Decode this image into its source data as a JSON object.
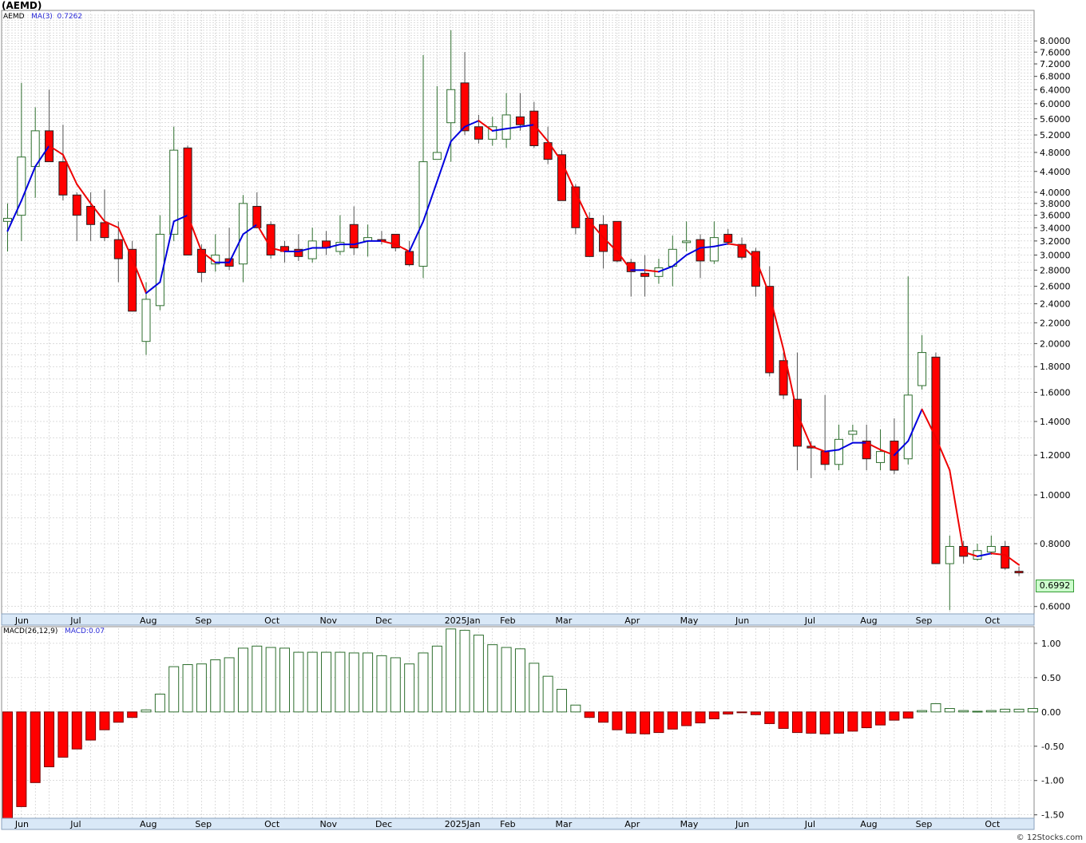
{
  "ticker": "(AEMD)",
  "legend_price": {
    "symbol": "AEMD",
    "ma_label": "MA(3)",
    "ma_value": "0.7262"
  },
  "legend_macd": {
    "label": "MACD(26,12,9)",
    "value_label": "MACD:0.07"
  },
  "last_price": "0.6992",
  "credit": "© 12Stocks.com",
  "colors": {
    "up_stroke": "#2e6e2e",
    "down_fill": "#ff0000",
    "ma_up": "#0000dd",
    "ma_down": "#ee0000",
    "grid": "#bbbbbb",
    "badge_bg": "#ccffcc"
  },
  "chart_data": [
    {
      "type": "candlestick",
      "title": "(AEMD)",
      "scale": "log",
      "ylim": [
        0.58,
        9.2
      ],
      "y_tick_labels": [
        "8.0000",
        "7.6000",
        "7.2000",
        "6.8000",
        "6.4000",
        "6.0000",
        "5.6000",
        "5.2000",
        "4.8000",
        "4.4000",
        "4.0000",
        "3.8000",
        "3.6000",
        "3.4000",
        "3.2000",
        "3.0000",
        "2.8000",
        "2.6000",
        "2.4000",
        "2.2000",
        "2.0000",
        "1.8000",
        "1.6000",
        "1.4000",
        "1.2000",
        "1.0000",
        "0.8000",
        "0.6000"
      ],
      "x_month_labels": [
        {
          "label": "Jun",
          "week": 1
        },
        {
          "label": "Jul",
          "week": 5
        },
        {
          "label": "Aug",
          "week": 10
        },
        {
          "label": "Sep",
          "week": 14
        },
        {
          "label": "Oct",
          "week": 19
        },
        {
          "label": "Nov",
          "week": 23
        },
        {
          "label": "Dec",
          "week": 27
        },
        {
          "label": "2025Jan",
          "week": 32
        },
        {
          "label": "Feb",
          "week": 36
        },
        {
          "label": "Mar",
          "week": 40
        },
        {
          "label": "Apr",
          "week": 45
        },
        {
          "label": "May",
          "week": 49
        },
        {
          "label": "Jun",
          "week": 53
        },
        {
          "label": "Jul",
          "week": 58
        },
        {
          "label": "Aug",
          "week": 62
        },
        {
          "label": "Sep",
          "week": 66
        },
        {
          "label": "Oct",
          "week": 71
        }
      ],
      "ohlc": [
        [
          3.5,
          3.8,
          3.05,
          3.55
        ],
        [
          3.6,
          6.6,
          3.2,
          4.7
        ],
        [
          4.5,
          5.9,
          3.9,
          5.3
        ],
        [
          5.3,
          6.4,
          4.6,
          4.6
        ],
        [
          4.6,
          5.45,
          3.85,
          3.95
        ],
        [
          3.95,
          4.0,
          3.2,
          3.6
        ],
        [
          3.75,
          4.0,
          3.2,
          3.45
        ],
        [
          3.48,
          4.05,
          3.2,
          3.25
        ],
        [
          3.22,
          3.5,
          2.65,
          2.95
        ],
        [
          3.08,
          3.2,
          2.45,
          2.32
        ],
        [
          2.02,
          2.65,
          1.9,
          2.45
        ],
        [
          2.38,
          3.6,
          2.33,
          3.3
        ],
        [
          3.3,
          5.4,
          3.2,
          4.85
        ],
        [
          4.9,
          4.95,
          3.0,
          3.0
        ],
        [
          3.08,
          3.15,
          2.65,
          2.77
        ],
        [
          2.88,
          3.3,
          2.78,
          3.0
        ],
        [
          2.95,
          3.4,
          2.8,
          2.85
        ],
        [
          2.88,
          3.95,
          2.65,
          3.8
        ],
        [
          3.75,
          4.0,
          3.4,
          3.4
        ],
        [
          3.45,
          3.5,
          2.95,
          3.0
        ],
        [
          3.12,
          3.2,
          2.9,
          3.05
        ],
        [
          3.08,
          3.3,
          2.92,
          2.98
        ],
        [
          2.95,
          3.4,
          2.9,
          3.2
        ],
        [
          3.2,
          3.35,
          3.0,
          3.1
        ],
        [
          3.05,
          3.6,
          3.0,
          3.18
        ],
        [
          3.45,
          3.75,
          3.0,
          3.1
        ],
        [
          3.2,
          3.45,
          2.98,
          3.25
        ],
        [
          3.22,
          3.35,
          3.15,
          3.2
        ],
        [
          3.3,
          3.3,
          3.05,
          3.1
        ],
        [
          3.05,
          3.2,
          2.85,
          2.87
        ],
        [
          2.85,
          7.5,
          2.7,
          4.6
        ],
        [
          4.65,
          6.5,
          4.8,
          4.8
        ],
        [
          5.5,
          8.4,
          4.6,
          6.4
        ],
        [
          6.6,
          7.6,
          5.2,
          5.3
        ],
        [
          5.4,
          5.7,
          5.0,
          5.1
        ],
        [
          5.1,
          5.65,
          4.95,
          5.4
        ],
        [
          5.1,
          6.3,
          4.9,
          5.7
        ],
        [
          5.65,
          6.3,
          5.3,
          5.45
        ],
        [
          5.8,
          6.05,
          4.9,
          4.95
        ],
        [
          5.02,
          5.4,
          4.55,
          4.65
        ],
        [
          4.75,
          4.85,
          3.9,
          3.85
        ],
        [
          4.1,
          4.15,
          3.3,
          3.4
        ],
        [
          3.55,
          3.65,
          2.98,
          2.98
        ],
        [
          3.45,
          3.6,
          2.82,
          3.05
        ],
        [
          3.5,
          3.5,
          2.9,
          2.92
        ],
        [
          2.9,
          2.95,
          2.48,
          2.78
        ],
        [
          2.76,
          3.0,
          2.48,
          2.72
        ],
        [
          2.72,
          2.95,
          2.63,
          2.83
        ],
        [
          2.85,
          3.28,
          2.6,
          3.08
        ],
        [
          3.2,
          3.5,
          3.05,
          3.2
        ],
        [
          3.22,
          3.3,
          2.7,
          2.92
        ],
        [
          2.92,
          3.5,
          2.88,
          3.25
        ],
        [
          3.3,
          3.38,
          3.14,
          3.18
        ],
        [
          3.15,
          3.25,
          2.94,
          2.97
        ],
        [
          3.05,
          3.1,
          2.48,
          2.6
        ],
        [
          2.6,
          2.85,
          1.72,
          1.75
        ],
        [
          1.85,
          1.92,
          1.55,
          1.58
        ],
        [
          1.55,
          1.92,
          1.12,
          1.25
        ],
        [
          1.25,
          1.28,
          1.08,
          1.24
        ],
        [
          1.22,
          1.58,
          1.12,
          1.15
        ],
        [
          1.15,
          1.38,
          1.12,
          1.29
        ],
        [
          1.32,
          1.38,
          1.28,
          1.34
        ],
        [
          1.28,
          1.38,
          1.12,
          1.18
        ],
        [
          1.16,
          1.35,
          1.12,
          1.22
        ],
        [
          1.28,
          1.42,
          1.1,
          1.12
        ],
        [
          1.18,
          2.72,
          1.15,
          1.58
        ],
        [
          1.65,
          2.08,
          1.62,
          1.92
        ],
        [
          1.88,
          1.92,
          0.73,
          0.73
        ],
        [
          0.73,
          0.83,
          0.59,
          0.79
        ],
        [
          0.79,
          0.81,
          0.73,
          0.755
        ],
        [
          0.745,
          0.8,
          0.74,
          0.775
        ],
        [
          0.77,
          0.83,
          0.76,
          0.79
        ],
        [
          0.79,
          0.81,
          0.71,
          0.715
        ],
        [
          0.705,
          0.72,
          0.69,
          0.7
        ]
      ],
      "ma3": [
        3.35,
        3.85,
        4.5,
        4.95,
        4.75,
        4.15,
        3.8,
        3.5,
        3.4,
        2.95,
        2.52,
        2.65,
        3.5,
        3.6,
        3.05,
        2.9,
        2.9,
        3.3,
        3.45,
        3.1,
        3.05,
        3.05,
        3.1,
        3.1,
        3.15,
        3.15,
        3.2,
        3.2,
        3.15,
        3.05,
        3.5,
        4.2,
        5.05,
        5.4,
        5.55,
        5.3,
        5.35,
        5.4,
        5.45,
        5.05,
        4.6,
        4.0,
        3.5,
        3.25,
        3.05,
        2.8,
        2.8,
        2.78,
        2.85,
        3.0,
        3.1,
        3.12,
        3.16,
        3.13,
        2.95,
        2.5,
        1.95,
        1.45,
        1.25,
        1.22,
        1.23,
        1.27,
        1.27,
        1.23,
        1.2,
        1.28,
        1.48,
        1.3,
        1.12,
        0.77,
        0.755,
        0.765,
        0.76,
        0.726
      ]
    },
    {
      "type": "bar",
      "title": "MACD(26,12,9)",
      "ylim": [
        -1.55,
        1.22
      ],
      "y_tick_labels": [
        "1.00",
        "0.50",
        "0.00",
        "-0.50",
        "-1.00",
        "-1.50"
      ],
      "values": [
        -1.55,
        -1.38,
        -1.03,
        -0.8,
        -0.66,
        -0.54,
        -0.41,
        -0.26,
        -0.15,
        -0.08,
        0.03,
        0.26,
        0.66,
        0.69,
        0.7,
        0.76,
        0.79,
        0.93,
        0.96,
        0.94,
        0.93,
        0.87,
        0.87,
        0.87,
        0.87,
        0.86,
        0.86,
        0.82,
        0.79,
        0.7,
        0.86,
        0.96,
        1.21,
        1.19,
        1.12,
        0.98,
        0.94,
        0.92,
        0.71,
        0.52,
        0.33,
        0.1,
        -0.08,
        -0.15,
        -0.26,
        -0.31,
        -0.32,
        -0.3,
        -0.25,
        -0.2,
        -0.16,
        -0.1,
        -0.03,
        -0.01,
        -0.04,
        -0.17,
        -0.24,
        -0.3,
        -0.31,
        -0.32,
        -0.31,
        -0.28,
        -0.23,
        -0.19,
        -0.12,
        -0.09,
        0.02,
        0.12,
        0.05,
        0.02,
        0.01,
        0.02,
        0.04,
        0.04,
        0.05
      ]
    }
  ]
}
